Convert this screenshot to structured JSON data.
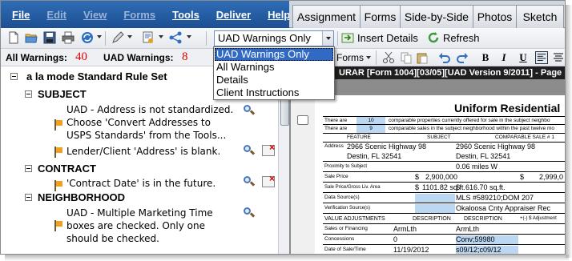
{
  "menu": [
    {
      "label": "File",
      "enabled": true
    },
    {
      "label": "Edit",
      "enabled": false
    },
    {
      "label": "View",
      "enabled": false
    },
    {
      "label": "Forms",
      "enabled": false
    },
    {
      "label": "Tools",
      "enabled": true
    },
    {
      "label": "Deliver",
      "enabled": true
    },
    {
      "label": "Help",
      "enabled": true
    }
  ],
  "tabs": [
    "Assignment",
    "Forms",
    "Side-by-Side",
    "Photos",
    "Sketch"
  ],
  "toolbar": {
    "filter_value": "UAD Warnings Only",
    "insert_details": "Insert Details",
    "refresh": "Refresh",
    "forms_menu": "Forms"
  },
  "filter_options": [
    "UAD Warnings Only",
    "All Warnings",
    "Details",
    "Client Instructions"
  ],
  "warnings": {
    "all_label": "All Warnings:",
    "all_count": "40",
    "uad_label": "UAD Warnings:",
    "uad_count": "8"
  },
  "tree": {
    "root": "a la mode Standard Rule Set",
    "sections": [
      {
        "title": "SUBJECT",
        "items": [
          {
            "lines": [
              "UAD - Address is not standardized.",
              "Choose 'Convert Addresses to",
              "USPS Standards' from the Tools..."
            ]
          },
          {
            "lines": [
              "Lender/Client 'Address' is blank."
            ]
          }
        ]
      },
      {
        "title": "CONTRACT",
        "items": [
          {
            "lines": [
              "'Contract Date' is in the future."
            ]
          }
        ]
      },
      {
        "title": "NEIGHBORHOOD",
        "items": [
          {
            "lines": [
              "UAD - Multiple Marketing Time",
              "boxes are checked.  Only one",
              "should be checked."
            ]
          }
        ]
      }
    ]
  },
  "form": {
    "titlebar": "URAR [Form 1004][03/05][UAD Version 9/2011] - Page",
    "title": "Uniform Residential",
    "rows": {
      "r1": {
        "a": "There are",
        "b": "10",
        "c": "comparable properties currently offered for sale in the subject neighbo"
      },
      "r2": {
        "a": "There are",
        "b": "9",
        "c": "comparable sales in the subject neighborhood within the past twelve mo"
      },
      "hdr": {
        "a": "FEATURE",
        "b": "SUBJECT",
        "c": "COMPARABLE SALE # 1"
      },
      "addr1": {
        "a": "Address",
        "b": "2966 Scenic Highway 98",
        "c": "2960 Scenic Highway 98"
      },
      "addr2": {
        "b": "Destin, FL 32541",
        "c": "Destin, FL 32541"
      },
      "prox": {
        "a": "Proximity to Subject",
        "c": "0.06 miles W"
      },
      "price": {
        "a": "Sale Price",
        "b": "$",
        "c": "2,900,000",
        "d": "$",
        "e": "2,999,0"
      },
      "pgla": {
        "a": "Sale Price/Gross Liv. Area",
        "b": "$",
        "c": "1101.82 sq.ft.",
        "d": "$",
        "e": "616.70 sq.ft."
      },
      "ds": {
        "a": "Data Source(s)",
        "c": "MLS #589210;DOM 207"
      },
      "vs": {
        "a": "Verification Source(s)",
        "c": "Okaloosa Cnty Appraiser Rec"
      },
      "va": {
        "a": "VALUE ADJUSTMENTS",
        "b": "DESCRIPTION",
        "c": "DESCRIPTION",
        "d": "+(-) $ Adjustment"
      },
      "fin": {
        "a": "Sales or Financing",
        "b": "ArmLth",
        "c": "ArmLth"
      },
      "con": {
        "a": "Concessions",
        "b": "0",
        "c": "Conv;59980"
      },
      "dos": {
        "a": "Date of Sale/Time",
        "b": "11/19/2012",
        "c": "s09/12;c09/12"
      }
    }
  }
}
